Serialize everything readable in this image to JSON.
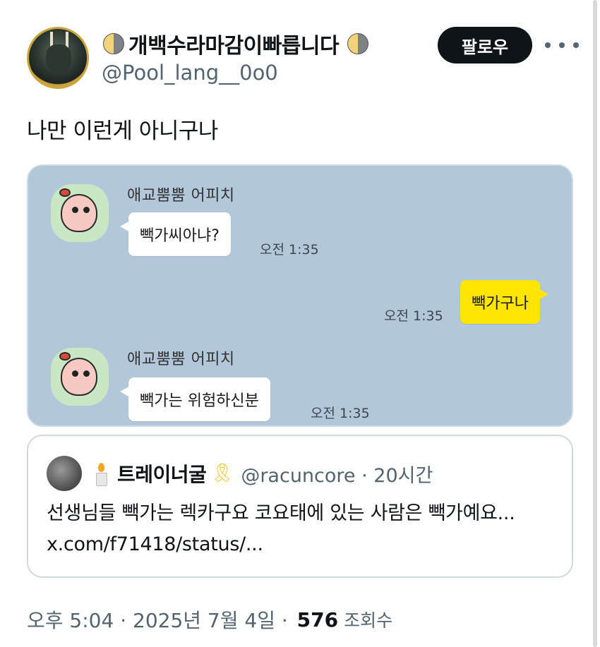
{
  "author": {
    "display_name": "개백수라마감이빠릅니다",
    "handle": "@Pool_lang__0o0",
    "left_emoji_icon": "half-moon-icon",
    "right_emoji_icon": "half-moon-icon"
  },
  "actions": {
    "follow_label": "팔로우",
    "more_icon": "more-horizontal-icon"
  },
  "tweet": {
    "text": "나만 이런게 아니구나"
  },
  "chat": {
    "background": "#b2c7da",
    "messages": [
      {
        "sender": "애교뿜뿜 어피치",
        "text": "빽가씨아냐?",
        "time": "오전 1:35",
        "mine": false
      },
      {
        "sender": "",
        "text": "빽가구나",
        "time": "오전 1:35",
        "mine": true
      },
      {
        "sender": "애교뿜뿜 어피치",
        "text": "빽가는 위험하신분",
        "time": "오전 1:35",
        "mine": false
      }
    ]
  },
  "quote": {
    "name": "트레이너굴",
    "handle_time": "@racuncore · 20시간",
    "emoji_before": "candle-icon",
    "emoji_after": "yellow-ribbon-icon",
    "text": "선생님들 빽가는 렉카구요 코요태에 있는 사람은 빽가예요... x.com/f71418/status/..."
  },
  "footer": {
    "datetime": "오후 5:04 · 2025년 7월 4일 · ",
    "views": "576",
    "views_label": "조회수"
  },
  "colors": {
    "follow_button": "#0f1419",
    "my_bubble": "#fee500",
    "secondary_text": "#536471"
  }
}
